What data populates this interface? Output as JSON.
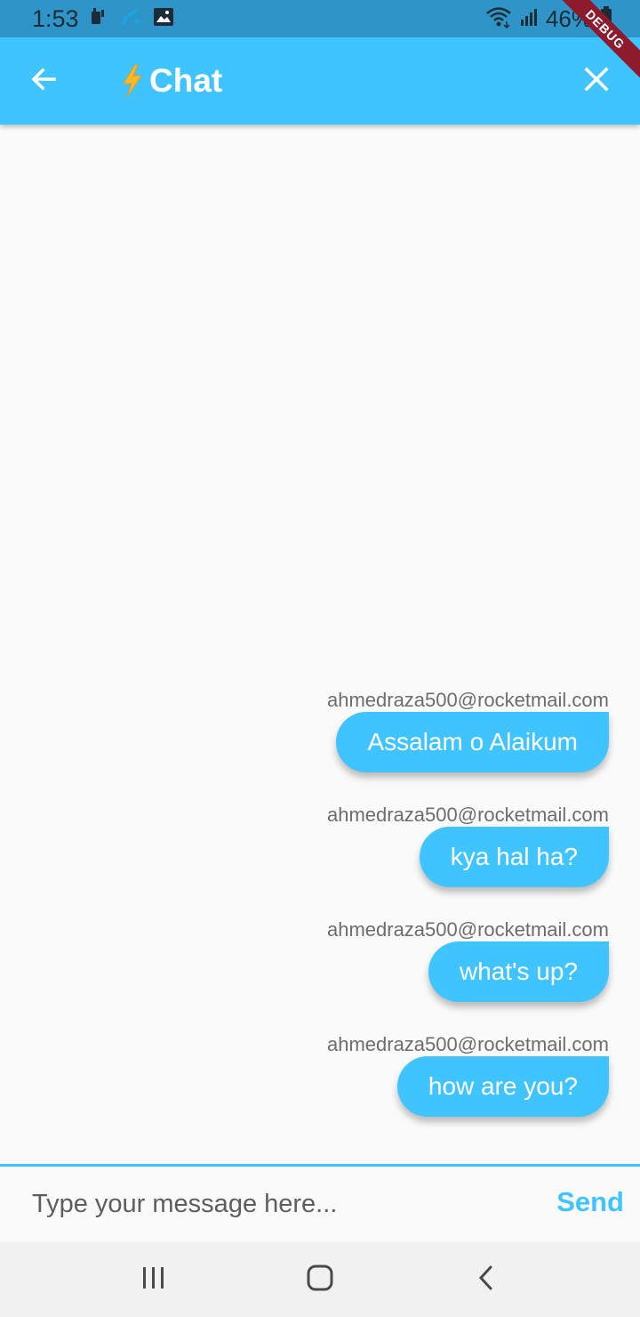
{
  "status_bar": {
    "time": "1:53",
    "battery": "46%",
    "icons_left": [
      "sim-icon",
      "signal-app-icon",
      "gallery-icon"
    ],
    "icons_right": [
      "wifi-icon",
      "cellular-signal-icon",
      "battery-icon"
    ]
  },
  "debug_banner": "DEBUG",
  "app_bar": {
    "title": "Chat",
    "title_icon": "lightning-icon",
    "back_icon": "back-arrow-icon",
    "close_icon": "close-icon",
    "background_color": "#40c4ff"
  },
  "messages": [
    {
      "sender": "ahmedraza500@rocketmail.com",
      "text": "Assalam o Alaikum"
    },
    {
      "sender": "ahmedraza500@rocketmail.com",
      "text": "kya hal ha?"
    },
    {
      "sender": "ahmedraza500@rocketmail.com",
      "text": "what's up?"
    },
    {
      "sender": "ahmedraza500@rocketmail.com",
      "text": "how are you?"
    }
  ],
  "composer": {
    "value": "",
    "placeholder": "Type your message here...",
    "send_label": "Send"
  },
  "nav_bar": {
    "items": [
      "recent-apps-icon",
      "home-icon",
      "back-icon"
    ]
  },
  "colors": {
    "accent": "#40c4ff",
    "status_bar": "#2f95c8",
    "background": "#fafafa"
  }
}
